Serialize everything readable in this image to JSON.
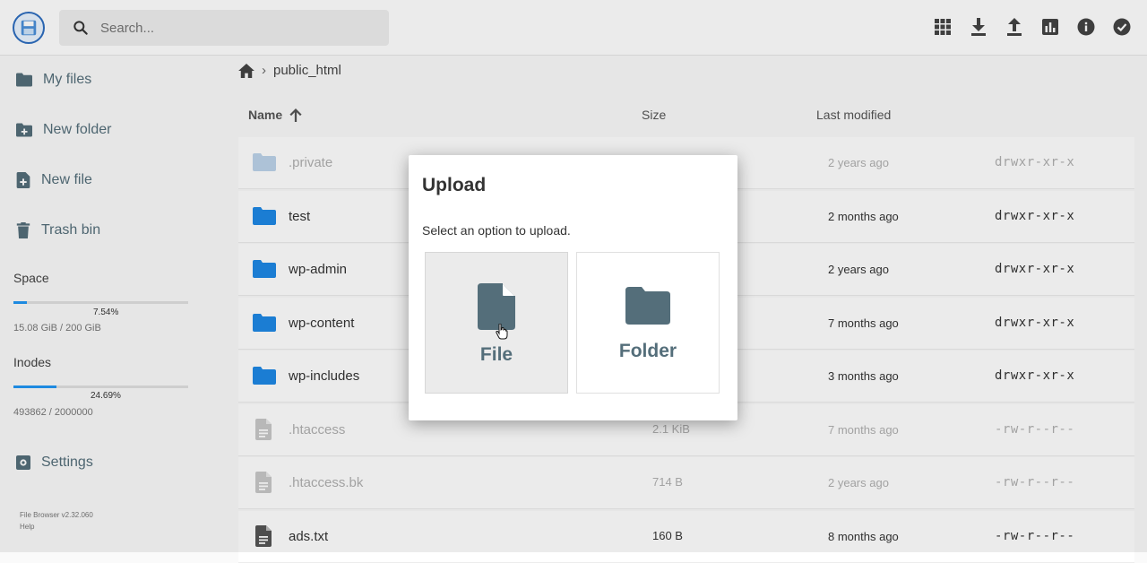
{
  "search": {
    "placeholder": "Search..."
  },
  "sidebar": {
    "items": [
      {
        "label": "My files"
      },
      {
        "label": "New folder"
      },
      {
        "label": "New file"
      },
      {
        "label": "Trash bin"
      }
    ],
    "space": {
      "title": "Space",
      "percent_label": "7.54%",
      "percent": 7.54,
      "usage": "15.08 GiB / 200 GiB"
    },
    "inodes": {
      "title": "Inodes",
      "percent_label": "24.69%",
      "percent": 24.69,
      "usage": "493862 / 2000000"
    },
    "settings": {
      "label": "Settings"
    },
    "footer": {
      "version": "File Browser v2.32.060",
      "help": "Help"
    }
  },
  "breadcrumb": {
    "path": "public_html"
  },
  "columns": {
    "name": "Name",
    "size": "Size",
    "modified": "Last modified"
  },
  "rows": [
    {
      "name": ".private",
      "size": "",
      "modified": "2 years ago",
      "perm": "drwxr-xr-x",
      "type": "folder",
      "dim": true
    },
    {
      "name": "test",
      "size": "",
      "modified": "2 months ago",
      "perm": "drwxr-xr-x",
      "type": "folder",
      "dim": false
    },
    {
      "name": "wp-admin",
      "size": "",
      "modified": "2 years ago",
      "perm": "drwxr-xr-x",
      "type": "folder",
      "dim": false
    },
    {
      "name": "wp-content",
      "size": "",
      "modified": "7 months ago",
      "perm": "drwxr-xr-x",
      "type": "folder",
      "dim": false
    },
    {
      "name": "wp-includes",
      "size": "",
      "modified": "3 months ago",
      "perm": "drwxr-xr-x",
      "type": "folder",
      "dim": false
    },
    {
      "name": ".htaccess",
      "size": "2.1 KiB",
      "modified": "7 months ago",
      "perm": "-rw-r--r--",
      "type": "file",
      "dim": true
    },
    {
      "name": ".htaccess.bk",
      "size": "714 B",
      "modified": "2 years ago",
      "perm": "-rw-r--r--",
      "type": "file",
      "dim": true
    },
    {
      "name": "ads.txt",
      "size": "160 B",
      "modified": "8 months ago",
      "perm": "-rw-r--r--",
      "type": "file",
      "dim": false
    }
  ],
  "modal": {
    "title": "Upload",
    "text": "Select an option to upload.",
    "file_label": "File",
    "folder_label": "Folder"
  },
  "colors": {
    "accent": "#2196f3",
    "folder_blue": "#1e88e5",
    "icon_gray": "#546e7a"
  }
}
